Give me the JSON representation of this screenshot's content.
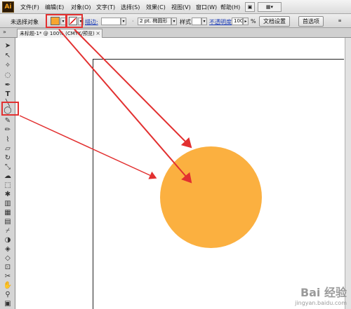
{
  "app": {
    "logo": "Ai"
  },
  "menu": {
    "items": [
      "文件(F)",
      "编辑(E)",
      "对象(O)",
      "文字(T)",
      "选择(S)",
      "效果(C)",
      "视图(V)",
      "窗口(W)",
      "帮助(H)"
    ]
  },
  "control_bar": {
    "selection_label": "未选择对象",
    "fill_color": "#f7a530",
    "stroke_label": "描边:",
    "brush_label": "2 pt. 椭圆形",
    "style_label": "样式:",
    "opacity_label": "不透明度:",
    "opacity_value": "100",
    "opacity_unit": "%",
    "doc_setup_button": "文档设置",
    "preferences_button": "首选项"
  },
  "document": {
    "tab_title": "未标题-1* @ 100% (CMYK/预览)",
    "tab_close": "×"
  },
  "canvas": {
    "circle_color": "#fbb040",
    "annotation_color": "#e23030"
  },
  "watermark": {
    "brand": "Bai 经验",
    "url": "jingyan.baidu.com"
  }
}
